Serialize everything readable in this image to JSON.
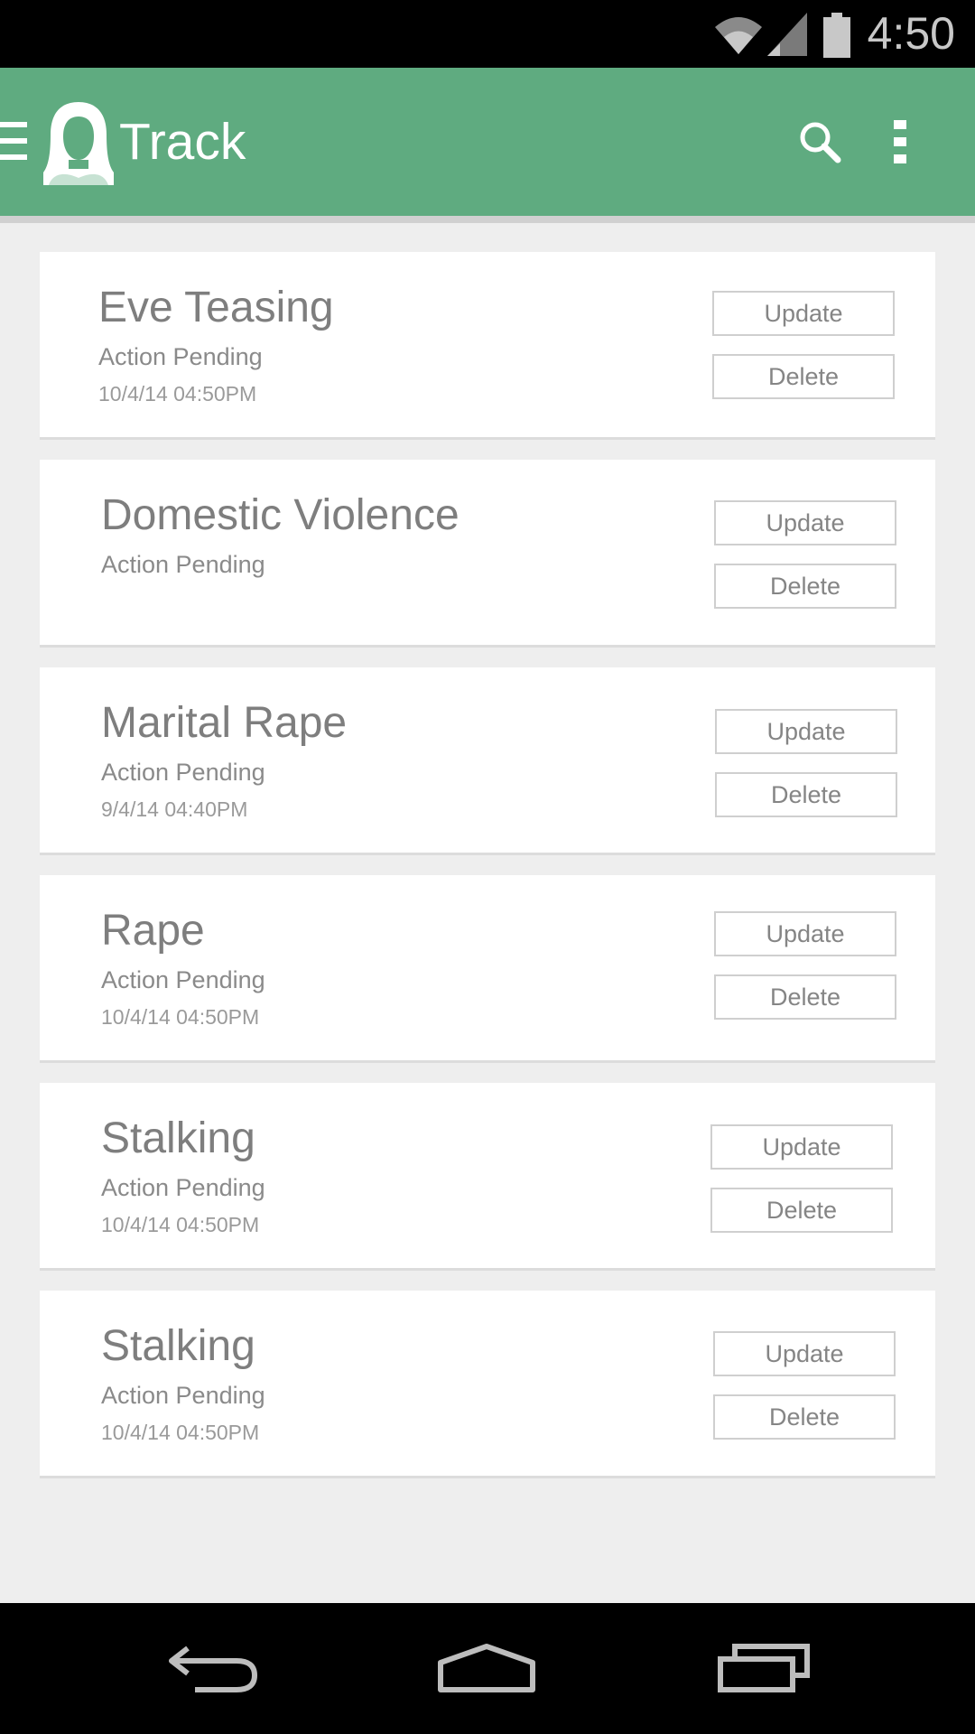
{
  "status_bar": {
    "time": "4:50",
    "icons": [
      "wifi-icon",
      "signal-icon",
      "battery-icon"
    ]
  },
  "app_bar": {
    "title": "Track",
    "icons": [
      "menu-icon",
      "woman-avatar-icon",
      "search-icon",
      "overflow-menu-icon"
    ],
    "color": "#5fab80"
  },
  "cases": [
    {
      "title": "Eve Teasing",
      "status": "Action Pending",
      "date": "10/4/14 04:50PM",
      "update_label": "Update",
      "delete_label": "Delete"
    },
    {
      "title": "Domestic Violence",
      "status": "Action Pending",
      "date": "",
      "update_label": "Update",
      "delete_label": "Delete"
    },
    {
      "title": "Marital Rape",
      "status": "Action Pending",
      "date": "9/4/14 04:40PM",
      "update_label": "Update",
      "delete_label": "Delete"
    },
    {
      "title": "Rape",
      "status": "Action Pending",
      "date": "10/4/14 04:50PM",
      "update_label": "Update",
      "delete_label": "Delete"
    },
    {
      "title": "Stalking",
      "status": "Action Pending",
      "date": "10/4/14 04:50PM",
      "update_label": "Update",
      "delete_label": "Delete"
    },
    {
      "title": "Stalking",
      "status": "Action Pending",
      "date": "10/4/14 04:50PM",
      "update_label": "Update",
      "delete_label": "Delete"
    }
  ],
  "nav_bar": {
    "icons": [
      "back-icon",
      "home-icon",
      "recents-icon"
    ]
  }
}
